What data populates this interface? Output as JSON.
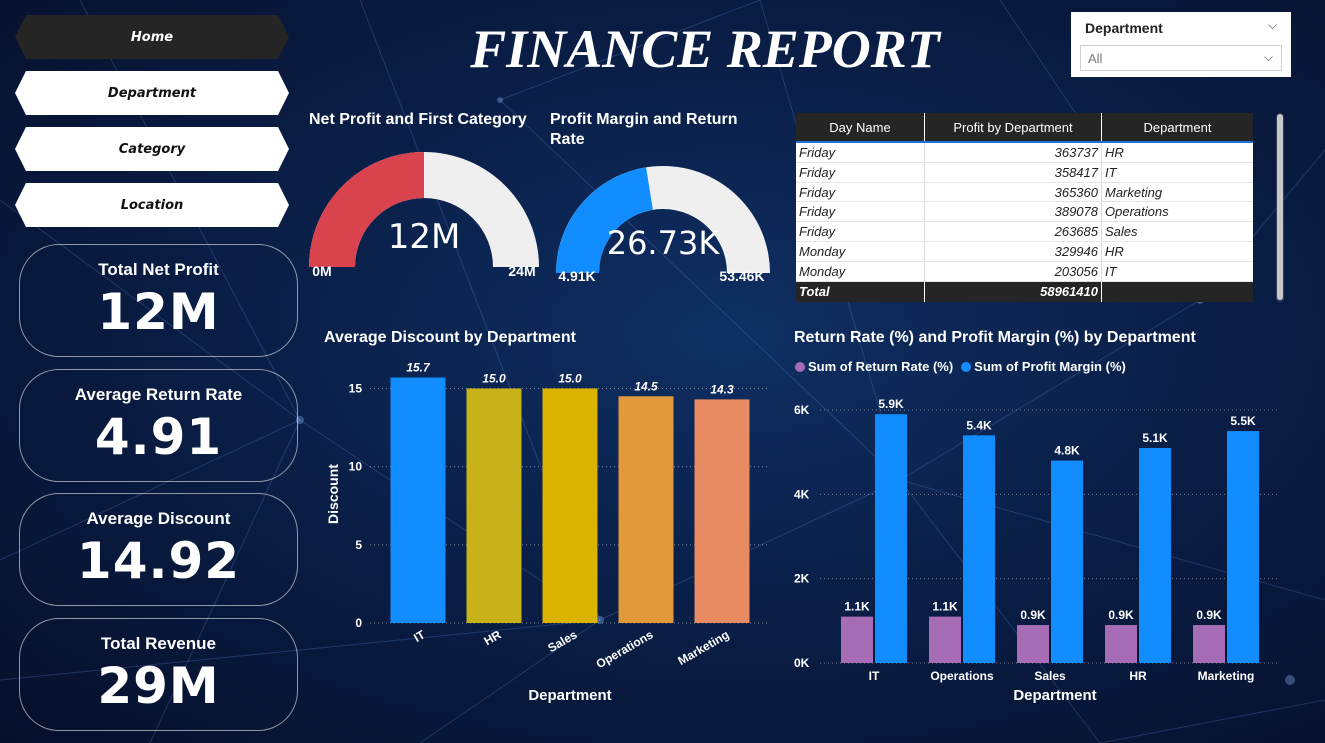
{
  "title": "FINANCE REPORT",
  "nav": {
    "home": "Home",
    "department": "Department",
    "category": "Category",
    "location": "Location"
  },
  "kpis": {
    "total_net_profit": {
      "label": "Total Net Profit",
      "value": "12M"
    },
    "average_return_rate": {
      "label": "Average Return Rate",
      "value": "4.91"
    },
    "average_discount": {
      "label": "Average Discount",
      "value": "14.92"
    },
    "total_revenue": {
      "label": "Total Revenue",
      "value": "29M"
    }
  },
  "slicer": {
    "label": "Department",
    "value": "All"
  },
  "gauges": {
    "net_profit": {
      "title": "Net Profit and First Category",
      "value_label": "12M",
      "min_label": "0M",
      "max_label": "24M",
      "value": 12,
      "min": 0,
      "max": 24,
      "color": "#D9434E"
    },
    "profit_margin": {
      "title": "Profit Margin and Return Rate",
      "value_label": "26.73K",
      "min_label": "4.91K",
      "max_label": "53.46K",
      "value": 26.73,
      "min": 4.91,
      "max": 53.46,
      "color": "#118DFF"
    }
  },
  "table": {
    "headers": [
      "Day Name",
      "Profit by Department",
      "Department"
    ],
    "rows": [
      [
        "Friday",
        "363737",
        "HR"
      ],
      [
        "Friday",
        "358417",
        "IT"
      ],
      [
        "Friday",
        "365360",
        "Marketing"
      ],
      [
        "Friday",
        "389078",
        "Operations"
      ],
      [
        "Friday",
        "263685",
        "Sales"
      ],
      [
        "Monday",
        "329946",
        "HR"
      ],
      [
        "Monday",
        "203056",
        "IT"
      ]
    ],
    "total": [
      "Total",
      "58961410",
      ""
    ]
  },
  "chart_data": [
    {
      "type": "bar",
      "title": "Average Discount by Department",
      "xlabel": "Department",
      "ylabel": "Discount",
      "categories": [
        "IT",
        "HR",
        "Sales",
        "Operations",
        "Marketing"
      ],
      "values": [
        15.7,
        15.0,
        15.0,
        14.5,
        14.3
      ],
      "value_labels": [
        "15.7",
        "15.0",
        "15.0",
        "14.5",
        "14.3"
      ],
      "colors": [
        "#118DFF",
        "#C8B21A",
        "#D9B300",
        "#E2993A",
        "#E88A62"
      ],
      "yticks": [
        "0",
        "5",
        "10",
        "15"
      ],
      "ylim": [
        0,
        16.5
      ],
      "grid": true
    },
    {
      "type": "bar",
      "title": "Return Rate (%) and Profit Margin (%) by Department",
      "xlabel": "Department",
      "categories": [
        "IT",
        "Operations",
        "Sales",
        "HR",
        "Marketing"
      ],
      "series": [
        {
          "name": "Sum of Return Rate (%)",
          "color": "#A66CB5",
          "values": [
            1.1,
            1.1,
            0.9,
            0.9,
            0.9
          ],
          "labels": [
            "1.1K",
            "1.1K",
            "0.9K",
            "0.9K",
            "0.9K"
          ]
        },
        {
          "name": "Sum of Profit Margin (%)",
          "color": "#118DFF",
          "values": [
            5.9,
            5.4,
            4.8,
            5.1,
            5.5
          ],
          "labels": [
            "5.9K",
            "5.4K",
            "4.8K",
            "5.1K",
            "5.5K"
          ]
        }
      ],
      "value_unit": "K",
      "yticks": [
        "0K",
        "2K",
        "4K",
        "6K"
      ],
      "ylim": [
        0,
        6
      ],
      "legend": "top-left",
      "grid": true
    }
  ]
}
